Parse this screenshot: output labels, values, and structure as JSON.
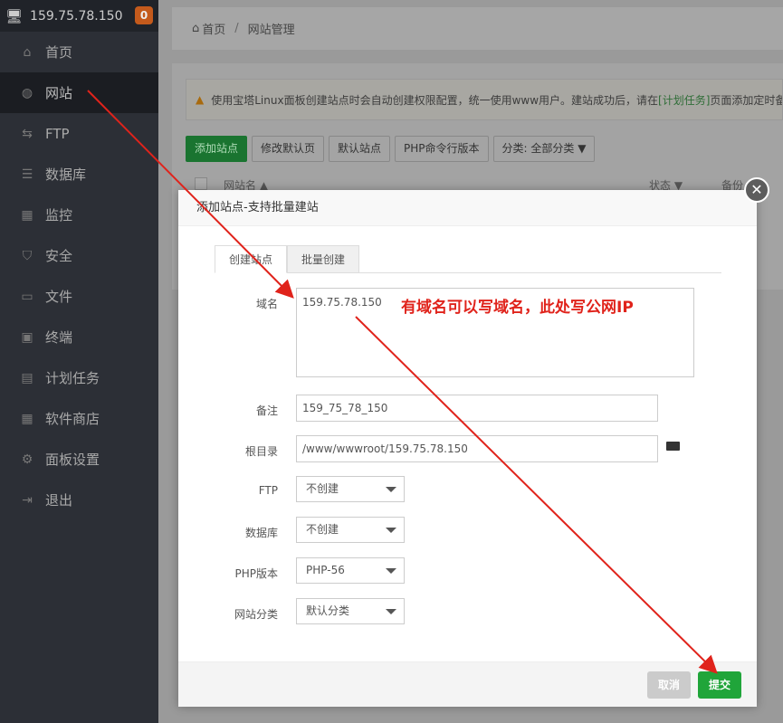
{
  "sidebar": {
    "server_ip": "159.75.78.150",
    "badge": "0",
    "items": [
      {
        "label": "首页",
        "icon": "home-icon"
      },
      {
        "label": "网站",
        "icon": "globe-icon",
        "active": true
      },
      {
        "label": "FTP",
        "icon": "ftp-icon"
      },
      {
        "label": "数据库",
        "icon": "database-icon"
      },
      {
        "label": "监控",
        "icon": "monitor-icon"
      },
      {
        "label": "安全",
        "icon": "shield-icon"
      },
      {
        "label": "文件",
        "icon": "folder-icon"
      },
      {
        "label": "终端",
        "icon": "terminal-icon"
      },
      {
        "label": "计划任务",
        "icon": "calendar-icon"
      },
      {
        "label": "软件商店",
        "icon": "grid-icon"
      },
      {
        "label": "面板设置",
        "icon": "gear-icon"
      },
      {
        "label": "退出",
        "icon": "logout-icon"
      }
    ]
  },
  "breadcrumb": {
    "home": "首页",
    "sep": "/",
    "current": "网站管理"
  },
  "notice": {
    "text_before": "使用宝塔Linux面板创建站点时会自动创建权限配置，统一使用www用户。建站成功后，请在",
    "link": "[计划任务]",
    "text_after": "页面添加定时备份任务"
  },
  "toolbar": {
    "add": "添加站点",
    "modify_default": "修改默认页",
    "default_site": "默认站点",
    "php_cli": "PHP命令行版本",
    "category": "分类: 全部分类"
  },
  "table": {
    "col_name": "网站名 ▲",
    "col_status": "状态 ▼",
    "col_backup": "备份"
  },
  "modal": {
    "title": "添加站点-支持批量建站",
    "close": "✕",
    "tabs": [
      "创建站点",
      "批量创建"
    ],
    "domain_label": "域名",
    "domain_value": "159.75.78.150",
    "remark_label": "备注",
    "remark_value": "159_75_78_150",
    "root_label": "根目录",
    "root_value": "/www/wwwroot/159.75.78.150",
    "ftp_label": "FTP",
    "ftp_value": "不创建",
    "db_label": "数据库",
    "db_value": "不创建",
    "php_label": "PHP版本",
    "php_value": "PHP-56",
    "cat_label": "网站分类",
    "cat_value": "默认分类",
    "cancel": "取消",
    "submit": "提交"
  },
  "annotation": {
    "text": "有域名可以写域名，此处写公网IP",
    "color": "#e0231b"
  }
}
